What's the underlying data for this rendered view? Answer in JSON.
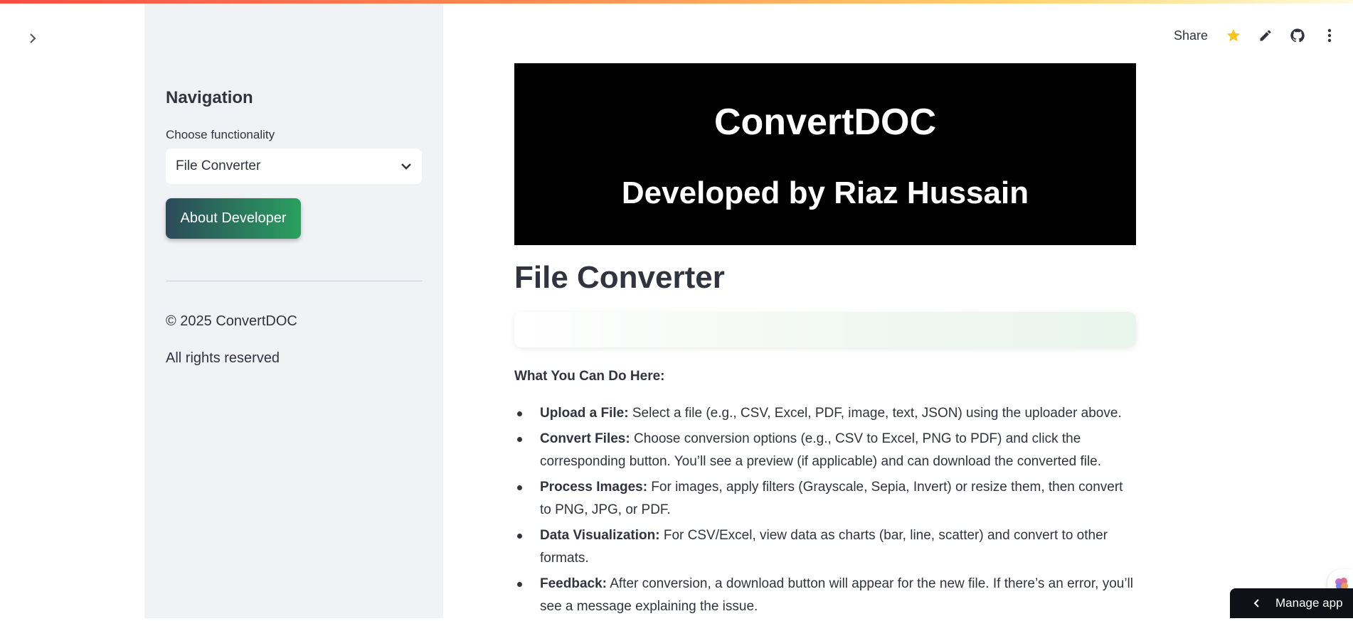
{
  "sidebar": {
    "nav_title": "Navigation",
    "select_label": "Choose functionality",
    "select_value": "File Converter",
    "about_button": "About Developer",
    "copyright": "© 2025 ConvertDOC",
    "rights": "All rights reserved"
  },
  "toolbar": {
    "share_label": "Share",
    "icons": [
      "star-icon",
      "pencil-icon",
      "github-icon",
      "more-vert-icon"
    ]
  },
  "banner": {
    "title": "ConvertDOC",
    "subtitle": "Developed by Riaz Hussain"
  },
  "main": {
    "page_title": "File Converter",
    "what_heading": "What You Can Do Here:",
    "features": [
      {
        "label": "Upload a File:",
        "text": " Select a file (e.g., CSV, Excel, PDF, image, text, JSON) using the uploader above."
      },
      {
        "label": "Convert Files:",
        "text": " Choose conversion options (e.g., CSV to Excel, PNG to PDF) and click the corresponding button. You’ll see a preview (if applicable) and can download the converted file."
      },
      {
        "label": "Process Images:",
        "text": " For images, apply filters (Grayscale, Sepia, Invert) or resize them, then convert to PNG, JPG, or PDF."
      },
      {
        "label": "Data Visualization:",
        "text": " For CSV/Excel, view data as charts (bar, line, scatter) and convert to other formats."
      },
      {
        "label": "Feedback:",
        "text": " After conversion, a download button will appear for the new file. If there’s an error, you’ll see a message explaining the issue."
      }
    ]
  },
  "footer": {
    "manage_app": "Manage app"
  },
  "colors": {
    "sidebar_bg": "#f0f2f6",
    "banner_bg": "#000000",
    "star": "#f5c518",
    "button_gradient_start": "#2b4a5a",
    "button_gradient_end": "#2a9f5f"
  }
}
